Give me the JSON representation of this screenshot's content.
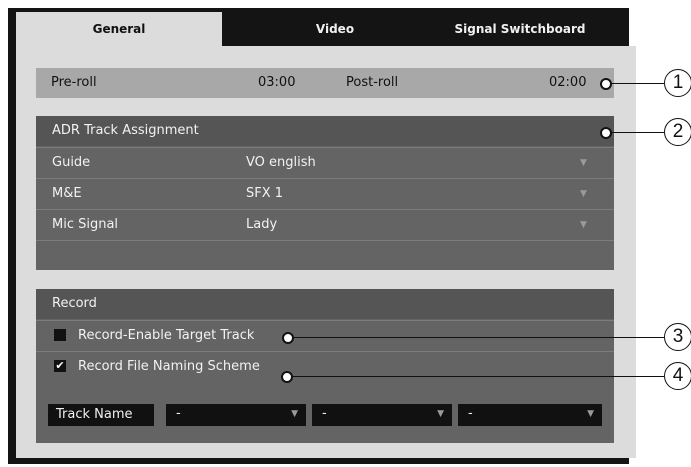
{
  "tabs": [
    {
      "label": "General",
      "active": true
    },
    {
      "label": "Video",
      "active": false
    },
    {
      "label": "Signal Switchboard",
      "active": false
    }
  ],
  "preroll": {
    "label": "Pre-roll",
    "value": "03:00"
  },
  "postroll": {
    "label": "Post-roll",
    "value": "02:00"
  },
  "adr": {
    "title": "ADR Track Assignment",
    "rows": [
      {
        "label": "Guide",
        "value": "VO english"
      },
      {
        "label": "M&E",
        "value": "SFX 1"
      },
      {
        "label": "Mic Signal",
        "value": "Lady"
      }
    ]
  },
  "record": {
    "title": "Record",
    "enable_target": {
      "label": "Record-Enable Target Track",
      "checked": false,
      "mark": ""
    },
    "naming_scheme": {
      "label": "Record File Naming Scheme",
      "checked": true,
      "mark": "✔"
    },
    "track_name_label": "Track Name",
    "scheme_fields": [
      "-",
      "-",
      "-"
    ]
  },
  "callouts": [
    "1",
    "2",
    "3",
    "4"
  ]
}
